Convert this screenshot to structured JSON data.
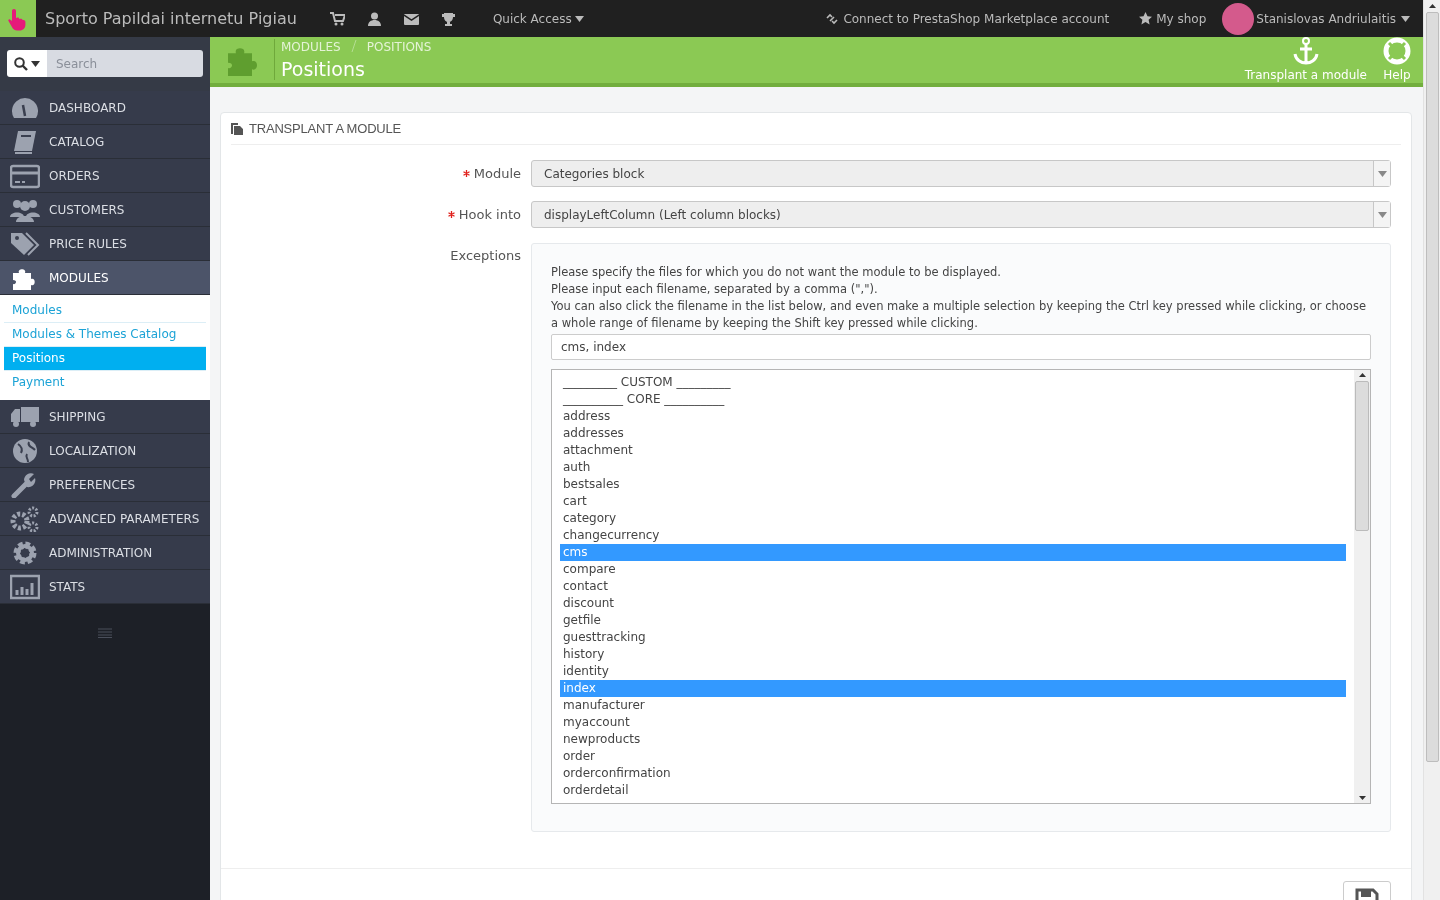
{
  "topbar": {
    "shop_name": "Sporto Papildai internetu Pigiau",
    "quick_access": "Quick Access",
    "marketplace_link": "Connect to PrestaShop Marketplace account",
    "my_shop": "My shop",
    "user_name": "Stanislovas Andriulaitis"
  },
  "sidebar": {
    "search_placeholder": "Search",
    "items": [
      {
        "label": "DASHBOARD",
        "selected": false
      },
      {
        "label": "CATALOG",
        "selected": false
      },
      {
        "label": "ORDERS",
        "selected": false
      },
      {
        "label": "CUSTOMERS",
        "selected": false
      },
      {
        "label": "PRICE RULES",
        "selected": false
      },
      {
        "label": "MODULES",
        "selected": true,
        "children": [
          {
            "label": "Modules",
            "selected": false
          },
          {
            "label": "Modules & Themes Catalog",
            "selected": false
          },
          {
            "label": "Positions",
            "selected": true
          },
          {
            "label": "Payment",
            "selected": false
          }
        ]
      },
      {
        "label": "SHIPPING",
        "selected": false
      },
      {
        "label": "LOCALIZATION",
        "selected": false
      },
      {
        "label": "PREFERENCES",
        "selected": false
      },
      {
        "label": "ADVANCED PARAMETERS",
        "selected": false
      },
      {
        "label": "ADMINISTRATION",
        "selected": false
      },
      {
        "label": "STATS",
        "selected": false
      }
    ]
  },
  "header": {
    "breadcrumb": [
      "MODULES",
      "POSITIONS"
    ],
    "title": "Positions",
    "toolbar": [
      {
        "label": "Transplant a module"
      },
      {
        "label": "Help"
      }
    ]
  },
  "panel": {
    "title": "TRANSPLANT A MODULE",
    "fields": [
      {
        "label": "Module",
        "required": true,
        "value": "Categories block"
      },
      {
        "label": "Hook into",
        "required": true,
        "value": "displayLeftColumn (Left column blocks)"
      }
    ],
    "exceptions": {
      "label": "Exceptions",
      "help": [
        "Please specify the files for which you do not want the module to be displayed.",
        "Please input each filename, separated by a comma (\",\").",
        "You can also click the filename in the list below, and even make a multiple selection by keeping the Ctrl key pressed while clicking, or choose a whole range of filename by keeping the Shift key pressed while clicking."
      ],
      "value": "cms, index",
      "options": [
        {
          "label": "_________ CUSTOM _________",
          "selected": false
        },
        {
          "label": "__________ CORE __________",
          "selected": false
        },
        {
          "label": "address",
          "selected": false
        },
        {
          "label": "addresses",
          "selected": false
        },
        {
          "label": "attachment",
          "selected": false
        },
        {
          "label": "auth",
          "selected": false
        },
        {
          "label": "bestsales",
          "selected": false
        },
        {
          "label": "cart",
          "selected": false
        },
        {
          "label": "category",
          "selected": false
        },
        {
          "label": "changecurrency",
          "selected": false
        },
        {
          "label": "cms",
          "selected": true
        },
        {
          "label": "compare",
          "selected": false
        },
        {
          "label": "contact",
          "selected": false
        },
        {
          "label": "discount",
          "selected": false
        },
        {
          "label": "getfile",
          "selected": false
        },
        {
          "label": "guesttracking",
          "selected": false
        },
        {
          "label": "history",
          "selected": false
        },
        {
          "label": "identity",
          "selected": false
        },
        {
          "label": "index",
          "selected": true
        },
        {
          "label": "manufacturer",
          "selected": false
        },
        {
          "label": "myaccount",
          "selected": false
        },
        {
          "label": "newproducts",
          "selected": false
        },
        {
          "label": "order",
          "selected": false
        },
        {
          "label": "orderconfirmation",
          "selected": false
        },
        {
          "label": "orderdetail",
          "selected": false
        }
      ]
    }
  }
}
